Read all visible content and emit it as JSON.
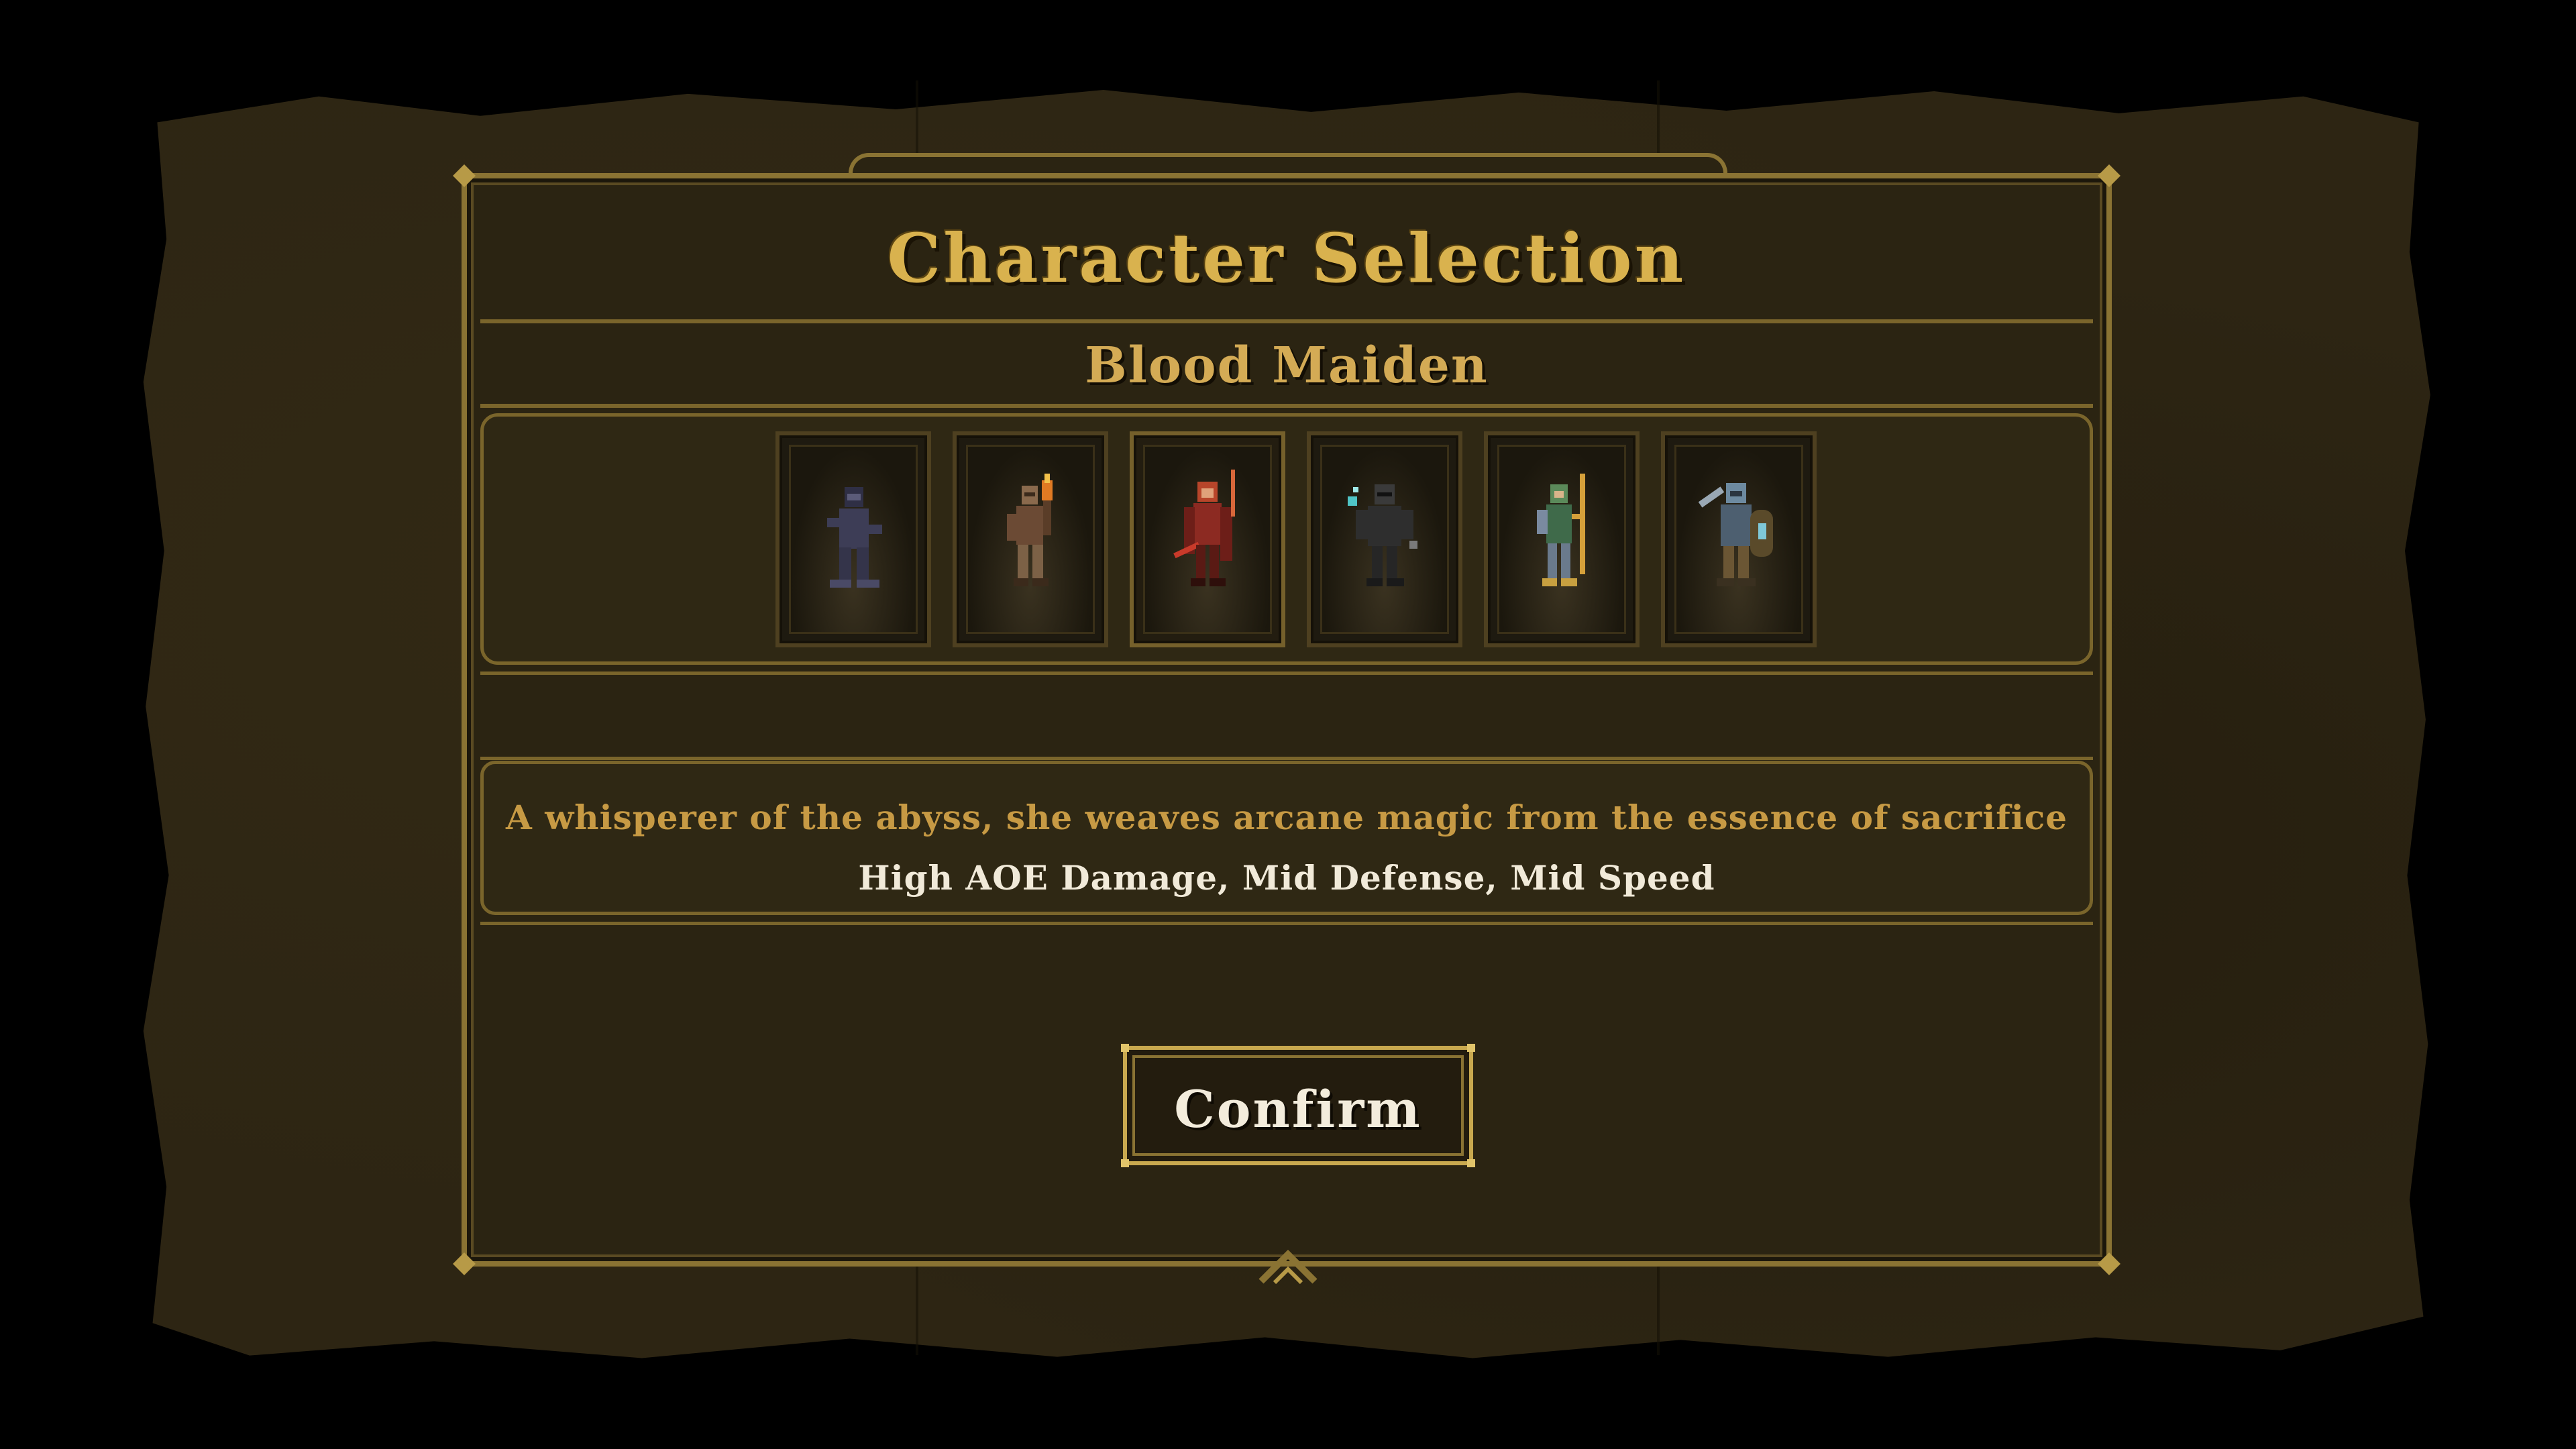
{
  "screen": {
    "title": "Character Selection",
    "selected_character": "Blood Maiden",
    "description": "A whisperer of the abyss, she weaves arcane magic from the essence of sacrifice",
    "stats": "High AOE Damage, Mid Defense, Mid Speed",
    "confirm_label": "Confirm"
  },
  "characters": [
    {
      "icon": "hooded-rogue-icon",
      "palette": {
        "body": "#3d3d56",
        "accent": "#5b5b78"
      }
    },
    {
      "icon": "torch-bearer-icon",
      "palette": {
        "body": "#6b4a34",
        "accent": "#e07a23"
      }
    },
    {
      "icon": "blood-maiden-icon",
      "palette": {
        "body": "#8c2a22",
        "accent": "#d8673a"
      },
      "selected": true
    },
    {
      "icon": "dark-knight-icon",
      "palette": {
        "body": "#2e2e2e",
        "accent": "#4fc4c6"
      }
    },
    {
      "icon": "elf-archer-icon",
      "palette": {
        "body": "#3f6a4a",
        "accent": "#d5a03a"
      }
    },
    {
      "icon": "shield-warrior-icon",
      "palette": {
        "body": "#4d5f70",
        "accent": "#7fc8d8"
      }
    }
  ],
  "colors": {
    "gold": "#d9b24e",
    "frame": "#8a7333",
    "panel": "#2b2412",
    "parchment": "#2d2513"
  }
}
